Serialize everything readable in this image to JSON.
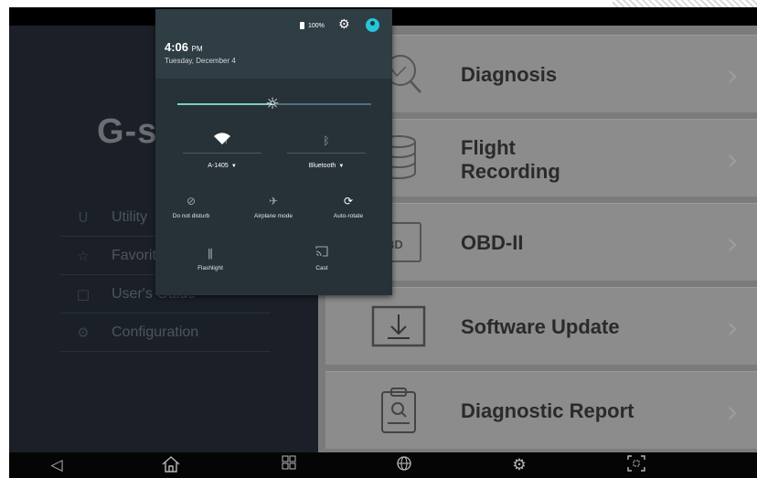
{
  "app": {
    "logo_text": "G-s",
    "menu": [
      {
        "label": "Utility",
        "icon": "utility-icon"
      },
      {
        "label": "Favorit",
        "icon": "star-icon"
      },
      {
        "label": "User's Guide",
        "icon": "book-icon"
      },
      {
        "label": "Configuration",
        "icon": "settings-icon"
      }
    ],
    "cards": [
      {
        "label": "Diagnosis",
        "icon": "diagnosis-search-icon"
      },
      {
        "label": "Flight\nRecording",
        "icon": "database-icon"
      },
      {
        "label": "OBD-II",
        "icon": "obd-icon"
      },
      {
        "label": "Software Update",
        "icon": "download-icon"
      },
      {
        "label": "Diagnostic Report",
        "icon": "clipboard-report-icon"
      }
    ]
  },
  "quick_settings": {
    "time": "4:06",
    "ampm": "PM",
    "date": "Tuesday, December 4",
    "battery": "100%",
    "brightness_level": 0.49,
    "wifi": {
      "label": "A-1405",
      "icon": "wifi-icon"
    },
    "bluetooth": {
      "label": "Bluetooth",
      "icon": "bluetooth-icon"
    },
    "tiles": [
      {
        "label": "Do not disturb",
        "icon": "do-not-disturb-icon",
        "active": false
      },
      {
        "label": "Airplane mode",
        "icon": "airplane-icon",
        "active": false
      },
      {
        "label": "Auto-rotate",
        "icon": "auto-rotate-icon",
        "active": true
      },
      {
        "label": "Flashlight",
        "icon": "flashlight-icon",
        "active": false
      },
      {
        "label": "Cast",
        "icon": "cast-icon",
        "active": false
      }
    ]
  },
  "navbar": [
    "back-icon",
    "home-icon",
    "recent-apps-icon",
    "globe-icon",
    "settings-gear-icon",
    "screenshot-icon"
  ],
  "colors": {
    "accent": "#80cbc4",
    "shade_bg": "#263238",
    "left_bg": "#1b2028",
    "right_bg": "#7b7b7b"
  }
}
